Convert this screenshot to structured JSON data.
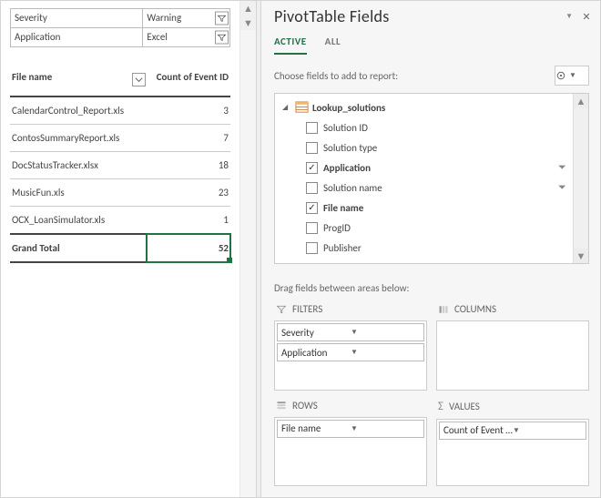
{
  "pane": {
    "title": "PivotTable Fields",
    "tab_active": "ACTIVE",
    "tab_all": "ALL",
    "choose_hint": "Choose fields to add to report:",
    "drag_hint": "Drag fields between areas below:",
    "table_name": "Lookup_solutions"
  },
  "filters": {
    "0": {
      "label": "Severity",
      "value": "Warning"
    },
    "1": {
      "label": "Application",
      "value": "Excel"
    }
  },
  "pivot": {
    "row_label": "File name",
    "value_label": "Count of Event ID",
    "rows": {
      "0": {
        "name": "CalendarControl_Report.xls",
        "count": "3"
      },
      "1": {
        "name": "ContosSummaryReport.xls",
        "count": "7"
      },
      "2": {
        "name": "DocStatusTracker.xlsx",
        "count": "18"
      },
      "3": {
        "name": "MusicFun.xls",
        "count": "23"
      },
      "4": {
        "name": "OCX_LoanSimulator.xls",
        "count": "1"
      }
    },
    "total_label": "Grand Total",
    "total_value": "52"
  },
  "fields": {
    "0": "Solution ID",
    "1": "Solution type",
    "2": "Application",
    "3": "Solution name",
    "4": "File name",
    "5": "ProgID",
    "6": "Publisher"
  },
  "areas": {
    "filters_label": "FILTERS",
    "columns_label": "COLUMNS",
    "rows_label": "ROWS",
    "values_label": "VALUES",
    "filter_chips": {
      "0": "Severity",
      "1": "Application"
    },
    "row_chips": {
      "0": "File name"
    },
    "value_chips": {
      "0": "Count of Event ID"
    }
  }
}
